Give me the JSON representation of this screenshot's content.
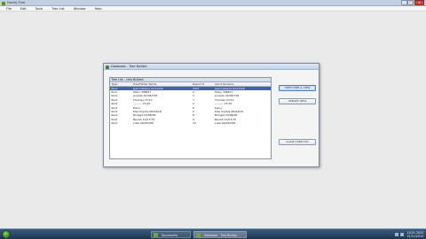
{
  "window": {
    "title": "Family Tree",
    "min_symbol": "–",
    "max_symbol": "□",
    "close_symbol": "✕"
  },
  "menu": [
    "File",
    "Edit",
    "Tools",
    "Tree List",
    "Window",
    "Help"
  ],
  "dialog": {
    "title": "Database - Tree Builder",
    "list_caption": "Tree List - Lists Bullted",
    "columns": [
      "Type",
      "Tree/Father Name",
      "Report #",
      "Short Rename"
    ],
    "rows": [
      [
        "Root",
        "Jean Celesce 01/12/26",
        "4421",
        "Jean Celesce 01/12/26"
      ],
      [
        "Root",
        "Molly 308827",
        "2",
        "Molly 308827"
      ],
      [
        "Root",
        "Jocaste 02/08/738",
        "3",
        "Jocaste 02/08/738"
      ],
      [
        "Root",
        "Thomas 27/10",
        "7",
        "Thomas 27/10"
      ],
      [
        "Root",
        "--------- 27/10",
        "5",
        "--------- 27/10"
      ],
      [
        "Root",
        "Dairy",
        "6",
        "Dairy"
      ],
      [
        "Root",
        "Elsa Sophia 08/04/18",
        "7",
        "Elsa Sophia 08/04/18"
      ],
      [
        "Root",
        "Bridget 03/08/48",
        "8",
        "Bridget 03/08/48"
      ],
      [
        "Root",
        "Benoit 11/07/70",
        "9",
        "Benoit 11/07/70"
      ],
      [
        "Root",
        "Luke 06/09/035",
        "10",
        "Luke 06/09/035"
      ]
    ],
    "selected_row": 0,
    "buttons": {
      "open": "OPEN TREE & VIEW",
      "update": "UPDATE VIEW",
      "close": "CLOSE TREE LIST"
    }
  },
  "taskbar": {
    "tasks": [
      "Documents",
      "Database - Tree Builder"
    ],
    "active_task": 1,
    "time": "10:21 2013",
    "date": "21/11/2013"
  }
}
